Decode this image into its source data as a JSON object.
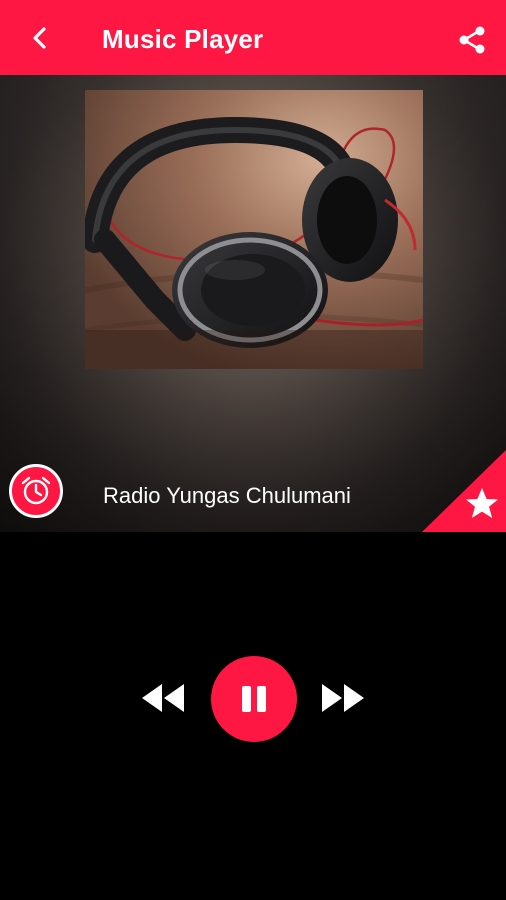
{
  "app_bar": {
    "title": "Music Player",
    "back_icon": "back-arrow-icon",
    "share_icon": "share-icon",
    "color": "#ff1744"
  },
  "now_playing": {
    "station_name": "Radio Yungas Chulumani",
    "artwork": "headphones-image",
    "sleep_timer_icon": "alarm-clock-icon",
    "favorite_icon": "star-icon"
  },
  "controls": {
    "rewind_icon": "rewind-icon",
    "play_state_icon": "pause-icon",
    "fast_forward_icon": "fast-forward-icon",
    "accent": "#ff1744"
  }
}
